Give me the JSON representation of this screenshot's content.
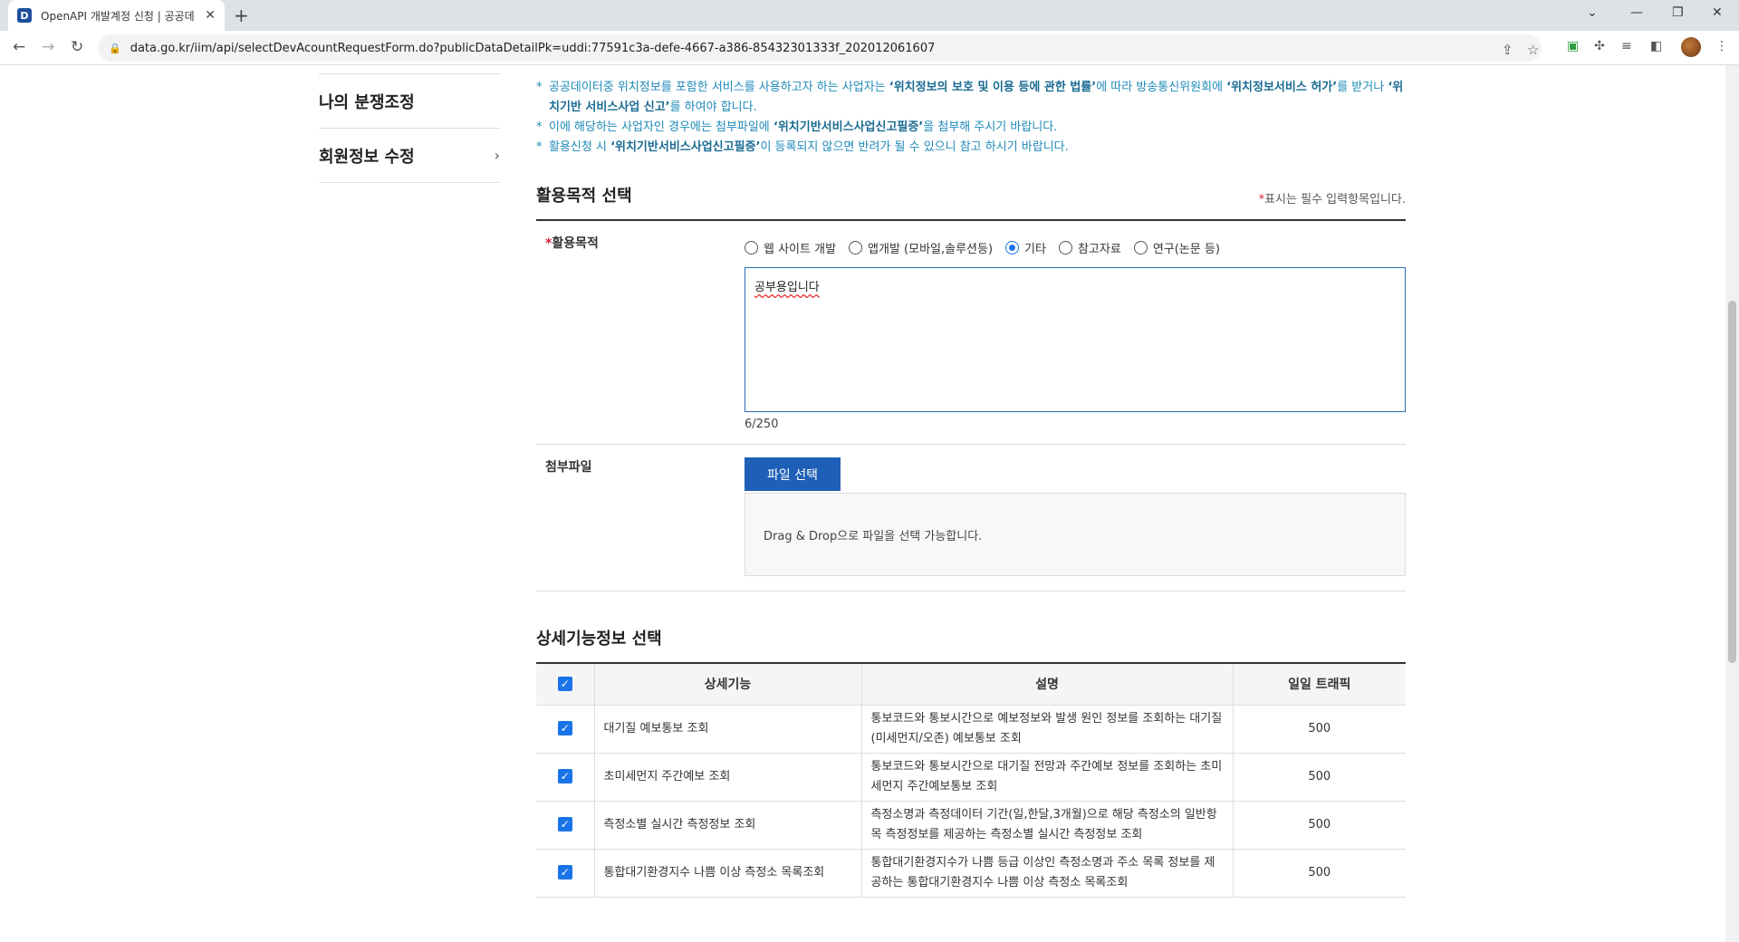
{
  "browser": {
    "tab_title": "OpenAPI 개발계정 신청 | 공공데",
    "url": "data.go.kr/iim/api/selectDevAcountRequestForm.do?publicDataDetailPk=uddi:77591c3a-defe-4667-a386-85432301333f_202012061607"
  },
  "sidebar": {
    "items": [
      {
        "label": "나의 분쟁조정"
      },
      {
        "label": "회원정보 수정"
      }
    ]
  },
  "notes": {
    "n1_a": "공공데이터중 위치정보를 포함한 서비스를 사용하고자 하는 사업자는 ",
    "n1_b": "‘위치정보의 보호 및 이용 등에 관한 법률’",
    "n1_c": "에 따라 방송통신위원회에 ",
    "n1_d": "‘위치정보서비스 허가’",
    "n1_e": "를 받거나 ",
    "n1_f": "‘위치기반 서비스사업 신고’",
    "n1_g": "를 하여야 합니다.",
    "n2_a": "이에 해당하는 사업자인 경우에는 첨부파일에 ",
    "n2_b": "‘위치기반서비스사업신고필증’",
    "n2_c": "을 첨부해 주시기 바랍니다.",
    "n3_a": "활용신청 시 ",
    "n3_b": "‘위치기반서비스사업신고필증’",
    "n3_c": "이 등록되지 않으면 반려가 될 수 있으니 참고 하시기 바랍니다."
  },
  "purpose": {
    "section_title": "활용목적 선택",
    "required_note": "표시는 필수 입력항목입니다.",
    "label": "활용목적",
    "options": [
      {
        "label": "웹 사이트 개발",
        "selected": false
      },
      {
        "label": "앱개발 (모바일,솔루션등)",
        "selected": false
      },
      {
        "label": "기타",
        "selected": true
      },
      {
        "label": "참고자료",
        "selected": false
      },
      {
        "label": "연구(논문 등)",
        "selected": false
      }
    ],
    "text_value": "공부용입니다",
    "counter": "6/250"
  },
  "attachment": {
    "label": "첨부파일",
    "button": "파일 선택",
    "dropzone_text": "Drag & Drop으로 파일을 선택 가능합니다."
  },
  "detail": {
    "section_title": "상세기능정보 선택",
    "headers": [
      "상세기능",
      "설명",
      "일일 트래픽"
    ],
    "rows": [
      {
        "name": "대기질 예보통보 조회",
        "desc": "통보코드와 통보시간으로 예보정보와 발생 원인 정보를 조회하는 대기질(미세먼지/오존) 예보통보 조회",
        "traffic": "500"
      },
      {
        "name": "초미세먼지 주간예보 조회",
        "desc": "통보코드와 통보시간으로 대기질 전망과 주간예보 정보를 조회하는 초미세먼지 주간예보통보 조회",
        "traffic": "500"
      },
      {
        "name": "측정소별 실시간 측정정보 조회",
        "desc": "측정소명과 측정데이터 기간(일,한달,3개월)으로 해당 측정소의 일반항목 측정정보를 제공하는 측정소별 실시간 측정정보 조회",
        "traffic": "500"
      },
      {
        "name": "통합대기환경지수 나쁨 이상 측정소 목록조회",
        "desc": "통합대기환경지수가 나쁨 등급 이상인 측정소명과 주소 목록 정보를 제공하는 통합대기환경지수 나쁨 이상 측정소 목록조회",
        "traffic": "500"
      }
    ]
  }
}
